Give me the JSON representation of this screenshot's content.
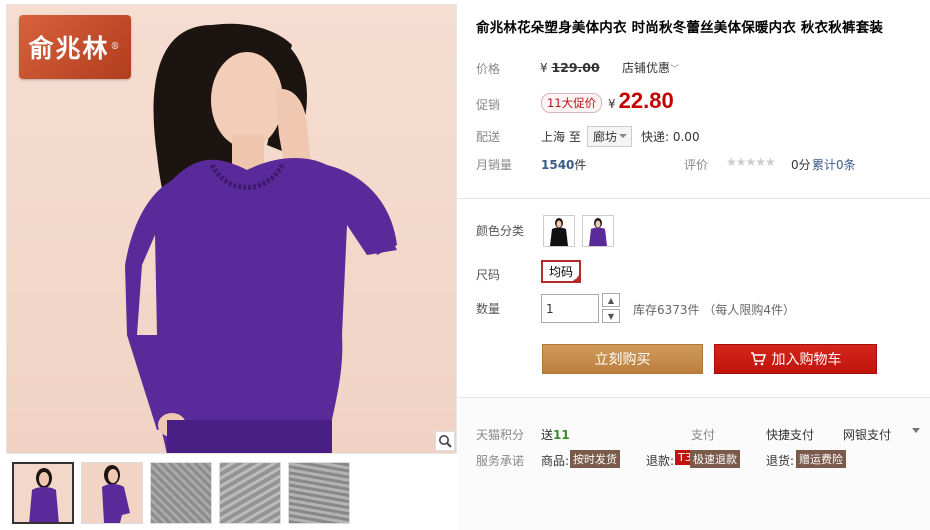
{
  "gallery": {
    "brand_logo": "俞兆林",
    "thumbnails": [
      "model-front",
      "model-pose",
      "lace-detail-1",
      "lace-detail-2",
      "lace-detail-3"
    ]
  },
  "product": {
    "title": "俞兆林花朵塑身美体内衣 时尚秋冬蕾丝美体保暖内衣 秋衣秋裤套装"
  },
  "price": {
    "label": "价格",
    "currency": "¥",
    "original": "129.00",
    "shop_promo": "店铺优惠",
    "promo_label": "促销",
    "promo_tag": "11大促价",
    "promo_price": "22.80"
  },
  "shipping": {
    "label": "配送",
    "from": "上海 至",
    "to": "廊坊",
    "fee": "快递: 0.00"
  },
  "sales": {
    "label": "月销量",
    "count": "1540",
    "unit": "件",
    "rating_label": "评价",
    "stars": "★★★★★",
    "rating_score": "0分",
    "rating_count": "累计0条"
  },
  "options": {
    "color_label": "颜色分类",
    "colors": [
      "black",
      "purple"
    ],
    "size_label": "尺码",
    "size_selected": "均码",
    "qty_label": "数量",
    "qty_value": "1",
    "stock": "库存6373件 （每人限购4件）"
  },
  "actions": {
    "buy_now": "立刻购买",
    "add_to_cart": "加入购物车"
  },
  "services": {
    "points_label": "天猫积分",
    "points_prefix": "送",
    "points_value": "11",
    "pay_label": "支付",
    "pay_options": [
      "快捷支付",
      "网银支付"
    ],
    "promise_label": "服务承诺",
    "promises": [
      {
        "prefix": "商品:",
        "badge": "按时发货"
      },
      {
        "prefix": "退款:",
        "badge_t3": "T3",
        "badge": "极速退款"
      },
      {
        "prefix": "退货:",
        "badge": "赠运费险"
      }
    ]
  },
  "colors": {
    "price_red": "#c40000",
    "buy_now_bg": "#c88e4c",
    "cart_bg": "#c0140c",
    "garment_purple": "#5a2a9a"
  }
}
